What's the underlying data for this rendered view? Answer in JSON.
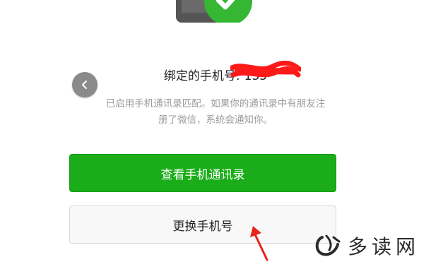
{
  "header": {
    "illustration": "phone-with-check-icon"
  },
  "binding": {
    "label": "绑定的手机号:",
    "number_visible": "135",
    "redacted": true
  },
  "description": {
    "line1": "已启用手机通讯录匹配。如果你的通讯录中有朋友注",
    "line2": "册了微信，系统会通知你。"
  },
  "actions": {
    "view_contacts_label": "查看手机通讯录",
    "change_phone_label": "更换手机号"
  },
  "watermark": {
    "text": "多读网"
  },
  "colors": {
    "primary_green": "#1aad19",
    "redaction_red": "#ff1a1a",
    "arrow_red": "#e8251b",
    "back_button_gray": "#8a8a8a"
  }
}
